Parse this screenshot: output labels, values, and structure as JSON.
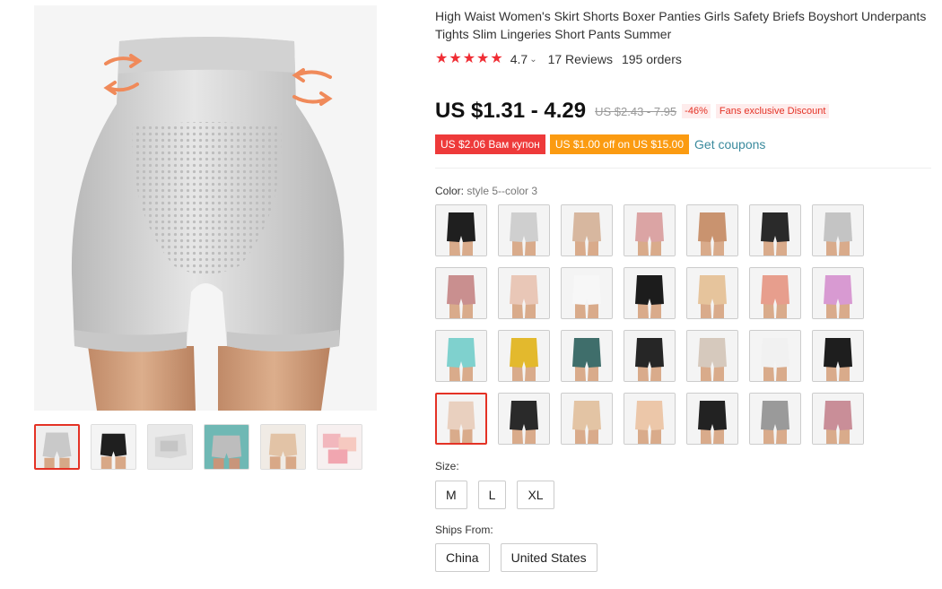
{
  "product": {
    "title": "High Waist Women's Skirt Shorts Boxer Panties Girls Safety Briefs Boyshort Underpants Tights Slim Lingeries Short Pants Summer",
    "rating": "4.7",
    "reviews": "17 Reviews",
    "orders": "195 orders"
  },
  "price": {
    "current": "US $1.31 - 4.29",
    "original": "US $2.43 - 7.95",
    "discount": "-46%",
    "fans_tag": "Fans exclusive Discount"
  },
  "coupons": {
    "red": "US $2.06 Вам купон",
    "orange": "US $1.00 off on US $15.00",
    "link": "Get coupons"
  },
  "color": {
    "label": "Color: ",
    "value": "style 5--color 3",
    "swatch_colors": [
      "#1f1f1f",
      "#cfcfcf",
      "#d7b79f",
      "#dba4a4",
      "#c9936f",
      "#2a2a2a",
      "#c4c4c4",
      "#c98f8f",
      "#e9c7b7",
      "#f7f7f7",
      "#1c1c1c",
      "#e6c49c",
      "#e79e8d",
      "#d89ad2",
      "#7fd1ce",
      "#e3b92d",
      "#3f6e6b",
      "#262626",
      "#d6c9bd",
      "#f1f1f1",
      "#1e1e1e",
      "#e9d0bf",
      "#2a2a2a",
      "#e3c4a4",
      "#ecc7a9",
      "#222222",
      "#9a9a9a",
      "#c98e98"
    ],
    "selected_index": 21
  },
  "size": {
    "label": "Size:",
    "options": [
      "M",
      "L",
      "XL"
    ]
  },
  "ships": {
    "label": "Ships From:",
    "options": [
      "China",
      "United States"
    ]
  },
  "gallery": {
    "thumb_colors": [
      "#c9c9c9",
      "#1f1f1f",
      "#d8d8d8",
      "#bdbdbd",
      "#e2c3a6",
      "#f2b7bd"
    ],
    "accent": "#e43225"
  }
}
